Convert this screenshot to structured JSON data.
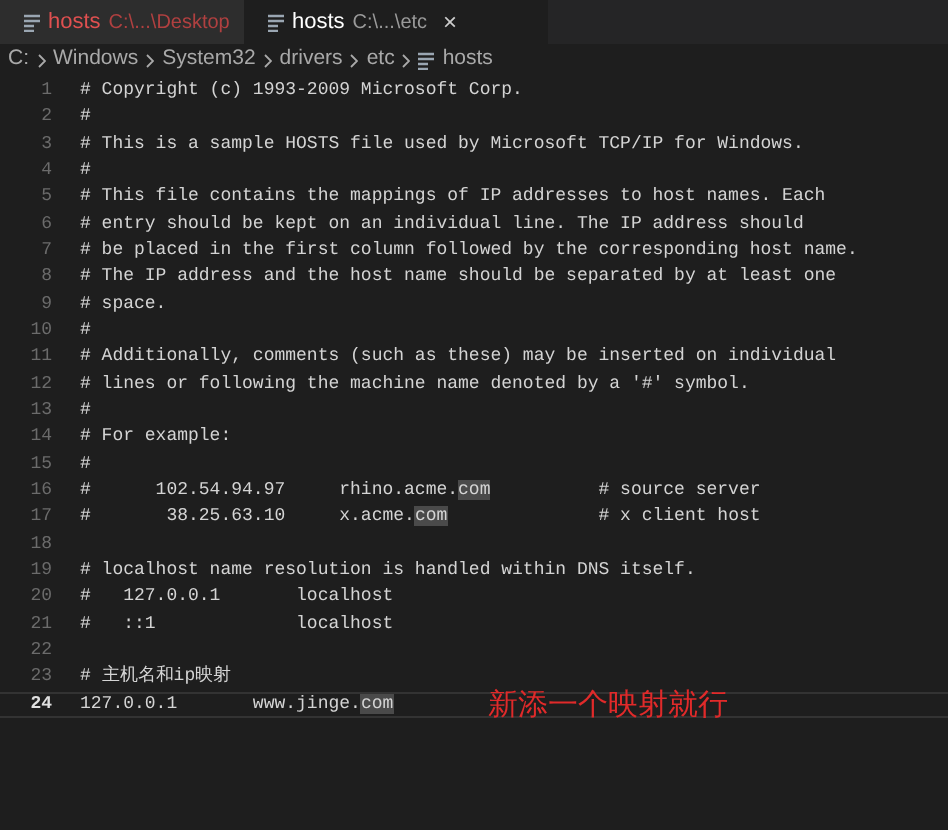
{
  "tabs": [
    {
      "name": "hosts",
      "path": "C:\\...\\Desktop",
      "selected": false,
      "modified": true
    },
    {
      "name": "hosts",
      "path": "C:\\...\\etc",
      "selected": true,
      "modified": false,
      "close": "×"
    }
  ],
  "breadcrumb": [
    "C:",
    "Windows",
    "System32",
    "drivers",
    "etc",
    "hosts"
  ],
  "lines": [
    {
      "number": "1",
      "segments": [
        {
          "text": "# Copyright (c) 1993-2009 Microsoft Corp.",
          "highlighted": false
        }
      ],
      "current": false
    },
    {
      "number": "2",
      "segments": [
        {
          "text": "#",
          "highlighted": false
        }
      ],
      "current": false
    },
    {
      "number": "3",
      "segments": [
        {
          "text": "# This is a sample HOSTS file used by Microsoft TCP/IP for Windows.",
          "highlighted": false
        }
      ],
      "current": false
    },
    {
      "number": "4",
      "segments": [
        {
          "text": "#",
          "highlighted": false
        }
      ],
      "current": false
    },
    {
      "number": "5",
      "segments": [
        {
          "text": "# This file contains the mappings of IP addresses to host names. Each",
          "highlighted": false
        }
      ],
      "current": false
    },
    {
      "number": "6",
      "segments": [
        {
          "text": "# entry should be kept on an individual line. The IP address should",
          "highlighted": false
        }
      ],
      "current": false
    },
    {
      "number": "7",
      "segments": [
        {
          "text": "# be placed in the first column followed by the corresponding host name.",
          "highlighted": false
        }
      ],
      "current": false
    },
    {
      "number": "8",
      "segments": [
        {
          "text": "# The IP address and the host name should be separated by at least one",
          "highlighted": false
        }
      ],
      "current": false
    },
    {
      "number": "9",
      "segments": [
        {
          "text": "# space.",
          "highlighted": false
        }
      ],
      "current": false
    },
    {
      "number": "10",
      "segments": [
        {
          "text": "#",
          "highlighted": false
        }
      ],
      "current": false
    },
    {
      "number": "11",
      "segments": [
        {
          "text": "# Additionally, comments (such as these) may be inserted on individual",
          "highlighted": false
        }
      ],
      "current": false
    },
    {
      "number": "12",
      "segments": [
        {
          "text": "# lines or following the machine name denoted by a '#' symbol.",
          "highlighted": false
        }
      ],
      "current": false
    },
    {
      "number": "13",
      "segments": [
        {
          "text": "#",
          "highlighted": false
        }
      ],
      "current": false
    },
    {
      "number": "14",
      "segments": [
        {
          "text": "# For example:",
          "highlighted": false
        }
      ],
      "current": false
    },
    {
      "number": "15",
      "segments": [
        {
          "text": "#",
          "highlighted": false
        }
      ],
      "current": false
    },
    {
      "number": "16",
      "segments": [
        {
          "text": "#      102.54.94.97     rhino.acme.",
          "highlighted": false
        },
        {
          "text": "com",
          "highlighted": true
        },
        {
          "text": "          # source server",
          "highlighted": false
        }
      ],
      "current": false
    },
    {
      "number": "17",
      "segments": [
        {
          "text": "#       38.25.63.10     x.acme.",
          "highlighted": false
        },
        {
          "text": "com",
          "highlighted": true
        },
        {
          "text": "              # x client host",
          "highlighted": false
        }
      ],
      "current": false
    },
    {
      "number": "18",
      "current": false
    },
    {
      "number": "19",
      "segments": [
        {
          "text": "# localhost name resolution is handled within DNS itself.",
          "highlighted": false
        }
      ],
      "current": false
    },
    {
      "number": "20",
      "segments": [
        {
          "text": "#   127.0.0.1       localhost",
          "highlighted": false
        }
      ],
      "current": false
    },
    {
      "number": "21",
      "segments": [
        {
          "text": "#   ::1             localhost",
          "highlighted": false
        }
      ],
      "current": false
    },
    {
      "number": "22",
      "current": false
    },
    {
      "number": "23",
      "segments": [
        {
          "text": "# 主机名和ip映射",
          "highlighted": false
        }
      ],
      "current": false
    },
    {
      "number": "24",
      "segments": [
        {
          "text": "127.0.0.1       www.jinge.",
          "highlighted": false
        },
        {
          "text": "com",
          "highlighted": true
        }
      ],
      "current": true
    }
  ],
  "annotation": "新添一个映射就行"
}
